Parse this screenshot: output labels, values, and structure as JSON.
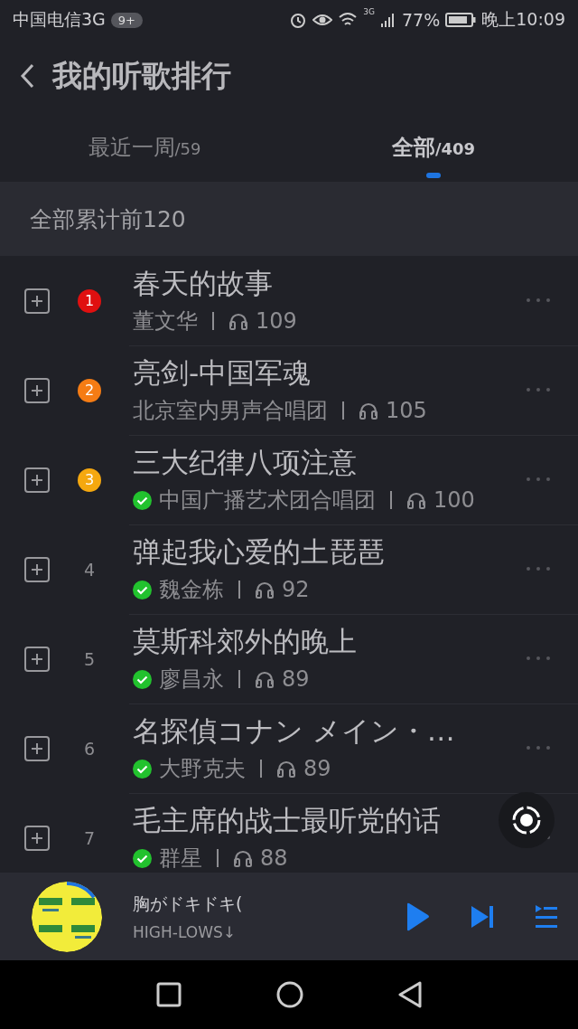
{
  "status_bar": {
    "carrier": "中国电信3G",
    "badge": "9+",
    "network": "3G",
    "battery": "77%",
    "time": "晚上10:09"
  },
  "header": {
    "title": "我的听歌排行"
  },
  "tabs": [
    {
      "label": "最近一周",
      "count": "/59",
      "selected": false
    },
    {
      "label": "全部",
      "count": "/409",
      "selected": true
    }
  ],
  "section": {
    "title": "全部累计前120"
  },
  "songs": [
    {
      "rank": "1",
      "color": "#e01010",
      "title": "春天的故事",
      "artist": "董文华",
      "plays": "109",
      "verified": false
    },
    {
      "rank": "2",
      "color": "#f57c14",
      "title": "亮剑-中国军魂",
      "artist": "北京室内男声合唱团",
      "plays": "105",
      "verified": false
    },
    {
      "rank": "3",
      "color": "#f5a80f",
      "title": "三大纪律八项注意",
      "artist": "中国广播艺术团合唱团",
      "plays": "100",
      "verified": true
    },
    {
      "rank": "4",
      "title": "弹起我心爱的土琵琶",
      "artist": "魏金栋",
      "plays": "92",
      "verified": true
    },
    {
      "rank": "5",
      "title": "莫斯科郊外的晚上",
      "artist": "廖昌永",
      "plays": "89",
      "verified": true
    },
    {
      "rank": "6",
      "title": "名探偵コナン メイン・…",
      "artist": "大野克夫",
      "plays": "89",
      "verified": true
    },
    {
      "rank": "7",
      "title": "毛主席的战士最听党的话",
      "artist": "群星",
      "plays": "88",
      "verified": true
    }
  ],
  "player": {
    "title": "胸がドキドキ(",
    "artist": "HIGH-LOWS↓"
  }
}
